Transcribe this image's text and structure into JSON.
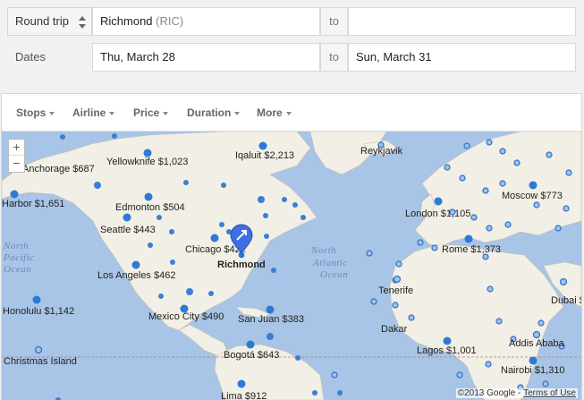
{
  "search": {
    "trip_type": "Round trip",
    "from_city": "Richmond",
    "from_code": "(RIC)",
    "to_label": "to",
    "dest_value": "",
    "dates_label": "Dates",
    "depart_date": "Thu, March 28",
    "dates_to_label": "to",
    "return_date": "Sun, March 31"
  },
  "filters": [
    "Stops",
    "Airline",
    "Price",
    "Duration",
    "More"
  ],
  "map": {
    "zoom_in": "+",
    "zoom_out": "−",
    "origin": "Richmond",
    "ocean_line1": "North",
    "ocean_line2": "Atlantic",
    "ocean_line3": "Ocean",
    "pacific_line1": "North",
    "pacific_line2": "Pacific",
    "pacific_line3": "Ocean",
    "copyright": "©2013 Google - ",
    "terms": "Terms of Use",
    "destinations": [
      {
        "label": "Anchorage $687"
      },
      {
        "label": "Yellowknife $1,023"
      },
      {
        "label": "Iqaluit $2,213"
      },
      {
        "label": "Harbor $1,651"
      },
      {
        "label": "Edmonton $504"
      },
      {
        "label": "Seattle $443"
      },
      {
        "label": "Chicago $421"
      },
      {
        "label": "Los Angeles $462"
      },
      {
        "label": "Honolulu $1,142"
      },
      {
        "label": "Mexico City $490"
      },
      {
        "label": "San Juan $383"
      },
      {
        "label": "Bogotá $643"
      },
      {
        "label": "Lima $912"
      },
      {
        "label": "Christmas Island"
      },
      {
        "label": "Reykjavik"
      },
      {
        "label": "London $1,105"
      },
      {
        "label": "Moscow $773"
      },
      {
        "label": "Rome $1,373"
      },
      {
        "label": "Tenerife"
      },
      {
        "label": "Dakar"
      },
      {
        "label": "Lagos $1,001"
      },
      {
        "label": "Addis Ababa"
      },
      {
        "label": "Nairobi $1,310"
      },
      {
        "label": "Dubai $"
      }
    ]
  }
}
